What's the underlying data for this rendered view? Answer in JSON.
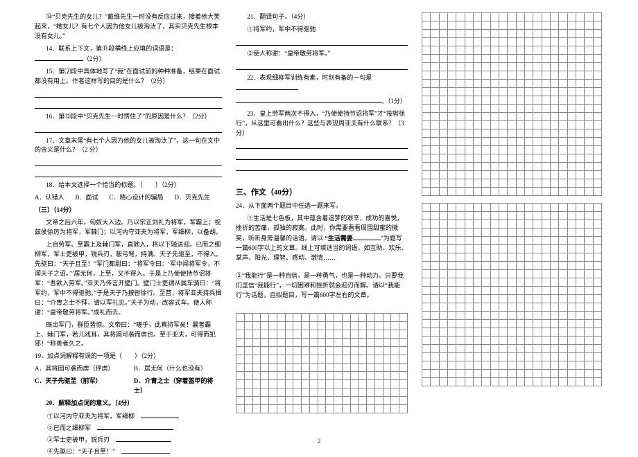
{
  "col1": {
    "p13": "⑬“贝克先生的女儿？”戴维先生一时没有反应过来，接着他大笑起来，“她女儿？有七个人因为他女儿被淘汰了，其实贝克先生根本没有女儿。”",
    "q14a": "14．联系上下文，第⑪段横线上应填的词语是：",
    "q14b": "（2分）",
    "q15a": "15．第⑵段中具体地写了“我”在面试前的种种准备，结果在面试都没有用上。作者这样写的目的是什么？（2分）",
    "q16": "16．第⑬段中“贝克先生一时愣住了”的原因是什么？（2分）",
    "q17": "17．文章末尾“有七个人因为他的女儿被淘汰了”，这一句在文中的含义是什么？（2 分）",
    "q18": "18．给本文选择一个恰当的标题。（　　）（2分）",
    "q18a": "A．认错人",
    "q18b": "B．面试",
    "q18c": "C．精心设计的骗局",
    "q18d": "D．贝克先生",
    "sect3": "（三）（14分）",
    "pa1": "文帝之后六年，匈奴大入边。乃以宗正刘礼为将军，军霸上；祝兹侯徐厉为将军，军棘门；以河内守亚夫为将军，军细柳，以备胡。",
    "pa2": "上自劳军。至霸上及棘门军，直驰入，将以下骑送迎。已而之细柳军，军士吏被甲，锐兵刃，彀弓弩，持满。天子先驱至，不得入。先驱曰：“天子且至！”军门都尉曰：“将军令曰：‘军中闻将军令，不闻天子之诏。’”居无何，上至，又不得入。于是上乃使使持节诏将军：“吾欲入劳军。”亚夫乃传言开壁门。壁门士吏谓从属车骑曰：“将军约，军中不得驱驰。”于是天子乃按辔徐行。至营，将军亚夫持兵揖曰：“介胄之士不拜，请以军礼见。”天子为动，改容式车。使人称谢：“皇帝敬劳将军。”成礼而去。",
    "pa3": "既出军门，群臣皆惊。文帝曰：“嗟乎，此真将军矣！曩者霸上、棘门军，若儿戏耳，其将固可袭而虏也。至于亚夫，可得而犯邪！“称善者久之。",
    "q19": "19．加点词解释有误的一项是（　　）（2分）",
    "q19a": "A．其将固可袭而虏（俘虏）",
    "q19b": "B．居无何（什么也没有）",
    "q19c": "C．天子先驱至（前军）",
    "q19d": "D．介胄之士（穿着盔甲的将士）",
    "q20": "20．解释加点词的意义。（4分）",
    "q20i1": "①以河内守亚夫为将军，军细柳",
    "q20i2": "②已而之细柳军",
    "q20i3": "③军士吏被甲，锐兵刃",
    "q20i4": "④先驱曰：“天子且至！”"
  },
  "col2": {
    "q21": "21．翻译句子。（4分）",
    "q21a": "①将军约，军中不得驱驰",
    "q21b": "②使人称谢：“皇帝敬劳将军。”",
    "q22a": "22．表现细柳军训练有素，时刻有备的一句是",
    "q22b": "。（1分）",
    "q23": "23．皇上劳军两次不得入，“乃使使持节诏将军”才“按辔徐行”，从这里可看出什么？这些与表现周亚夫有什么联系？（3分）",
    "sec3": "三、作文（40分）",
    "q24": "24．从下面两个题目中任选一题来写。",
    "t1a": "①生活是七色板，其中蕴含着追梦的艰辛，成功的喜悦，挫折的苦痛，孤独的寂寞。此时，你需要看看周围甜蜜的微笑，听听身旁温馨的话语。请以",
    "t1b": "“生活需要",
    "t1c": "”为题写一篇600字以上的文章。线上可填适当的词语，如互助、欢乐、掌声、阳光、理智、感动、激情……",
    "t2": "②“我能行”是一种自信，是一种勇气，也是一种动力。只要我们坚信“我能行”，一切困难和挫折就会迎刃而解。请以“我能行”为话题，自拟题目，写一篇600字左右的文章。"
  },
  "footer": "2"
}
